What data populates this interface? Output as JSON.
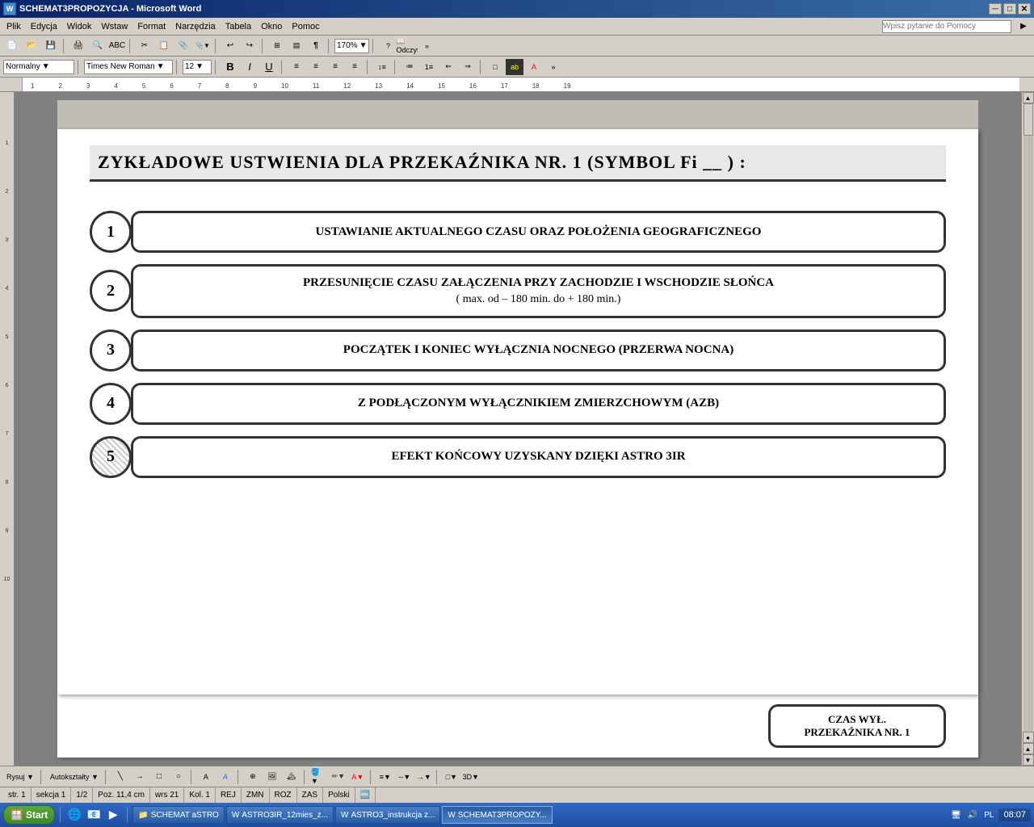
{
  "window": {
    "title": "SCHEMAT3PROPOZYCJA - Microsoft Word",
    "icon": "W"
  },
  "titlebar": {
    "minimize": "─",
    "maximize": "□",
    "close": "✕"
  },
  "menubar": {
    "items": [
      "Plik",
      "Edycja",
      "Widok",
      "Wstaw",
      "Format",
      "Narzędzia",
      "Tabela",
      "Okno",
      "Pomoc"
    ]
  },
  "help_bar": {
    "placeholder": "Wpisz pytanie do Pomocy"
  },
  "formatting": {
    "style": "Normalny",
    "font": "Times New Roman",
    "size": "12",
    "zoom": "170%"
  },
  "document": {
    "heading": "ZYKŁADOWE  USTWIENIA  DLA  PRZEKAŹNIKA  NR. 1   (SYMBOL  Fi __ ) :",
    "items": [
      {
        "number": "1",
        "text": "USTAWIANIE AKTUALNEGO CZASU ORAZ POŁOŻENIA GEOGRAFICZNEGO",
        "subtext": "",
        "hatched": false
      },
      {
        "number": "2",
        "text": "PRZESUNIĘCIE CZASU ZAŁĄCZENIA PRZY ZACHODZIE I WSCHODZIE SŁOŃCA",
        "subtext": "( max. od – 180 min. do + 180 min.)",
        "hatched": false
      },
      {
        "number": "3",
        "text": "POCZĄTEK I KONIEC WYŁĄCZNIA NOCNEGO     (PRZERWA NOCNA)",
        "subtext": "",
        "hatched": false
      },
      {
        "number": "4",
        "text": "Z PODŁĄCZONYM WYŁĄCZNIKIEM ZMIERZCHOWYM (AZB)",
        "subtext": "",
        "hatched": false
      },
      {
        "number": "5",
        "text": "EFEKT KOŃCOWY UZYSKANY DZIĘKI ASTRO 3IR",
        "subtext": "",
        "hatched": true
      }
    ],
    "partial_box": {
      "line1": "CZAS WYŁ.",
      "line2": "PRZEKAŹNIKA NR. 1"
    }
  },
  "statusbar": {
    "page": "str. 1",
    "section": "sekcja  1",
    "pages": "1/2",
    "position": "Poz. 11,4 cm",
    "line": "wrs 21",
    "col": "Kol. 1",
    "rej": "REJ",
    "zmn": "ZMN",
    "roz": "ROZ",
    "zas": "ZAS",
    "lang": "Polski"
  },
  "taskbar": {
    "start": "Start",
    "apps": [
      {
        "label": "SCHEMAT aSTRO",
        "active": false,
        "icon": "📁"
      },
      {
        "label": "ASTRO3IR_12mies_z...",
        "active": false,
        "icon": "W"
      },
      {
        "label": "ASTRO3_instrukcja z...",
        "active": false,
        "icon": "W"
      },
      {
        "label": "SCHEMAT3PROPOZY...",
        "active": true,
        "icon": "W"
      }
    ],
    "tray": {
      "lang": "PL",
      "time": "08:07"
    }
  }
}
